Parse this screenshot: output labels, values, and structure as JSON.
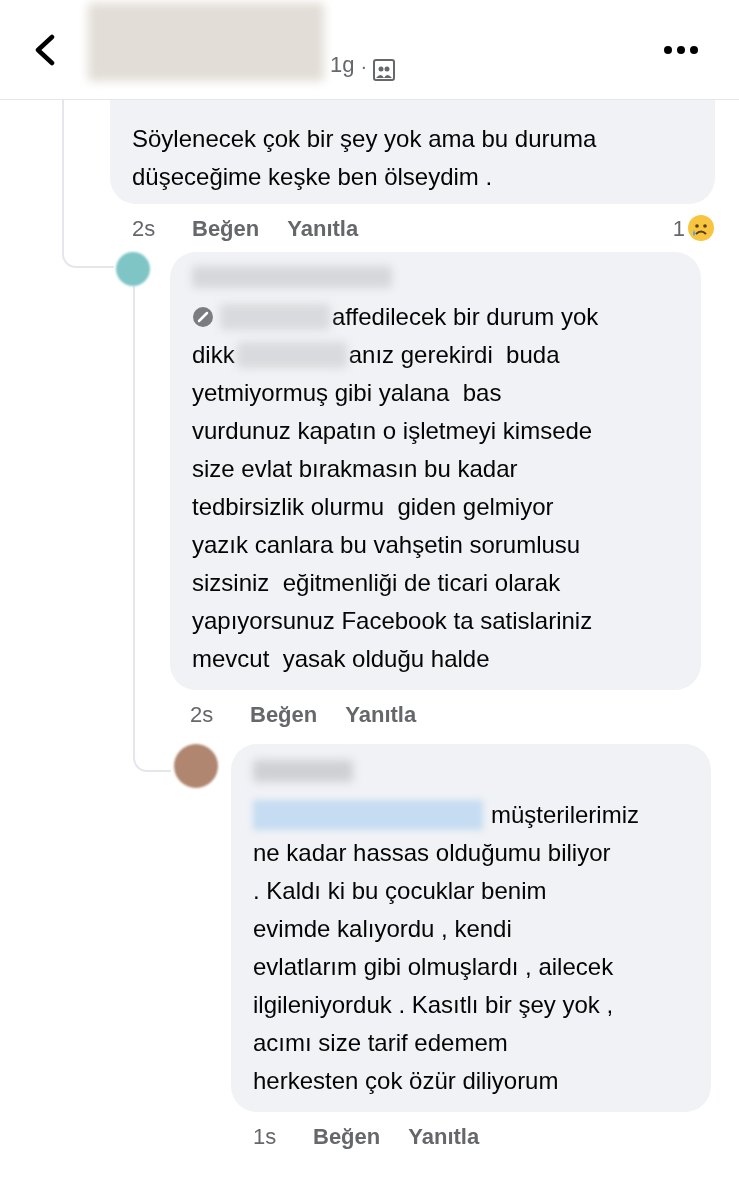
{
  "header": {
    "time": "1g",
    "separator": "·"
  },
  "comment": {
    "lines": [
      [
        {
          "kind": "text",
          "text": "Söylenecek çok bir şey yok ama bu duruma"
        }
      ],
      [
        {
          "kind": "text",
          "text": "düşeceğime keşke ben ölseydim ."
        }
      ]
    ],
    "time": "2s",
    "like": "Beğen",
    "reply": "Yanıtla",
    "reaction_count": "1",
    "reply_item": {
      "lines": [
        [
          {
            "kind": "badge"
          },
          {
            "kind": "redaction"
          },
          {
            "kind": "text",
            "text": "affedilecek bir durum yok"
          }
        ],
        [
          {
            "kind": "text",
            "text": "dikk"
          },
          {
            "kind": "redaction"
          },
          {
            "kind": "text",
            "text": "anız gerekirdi  buda"
          }
        ],
        [
          {
            "kind": "text",
            "text": "yetmiyormuş gibi yalana  bas"
          }
        ],
        [
          {
            "kind": "text",
            "text": "vurdunuz kapatın o işletmeyi kimsede"
          }
        ],
        [
          {
            "kind": "text",
            "text": "size evlat bırakmasın bu kadar"
          }
        ],
        [
          {
            "kind": "text",
            "text": "tedbirsizlik olurmu  giden gelmiyor"
          }
        ],
        [
          {
            "kind": "text",
            "text": "yazık canlara bu vahşetin sorumlusu"
          }
        ],
        [
          {
            "kind": "text",
            "text": "sizsiniz  eğitmenliği de ticari olarak"
          }
        ],
        [
          {
            "kind": "text",
            "text": "yapıyorsunuz Facebook ta satislariniz"
          }
        ],
        [
          {
            "kind": "text",
            "text": "mevcut  yasak olduğu halde"
          }
        ]
      ],
      "time": "2s",
      "like": "Beğen",
      "reply": "Yanıtla",
      "reply_item": {
        "lines": [
          [
            {
              "kind": "mention"
            },
            {
              "kind": "text",
              "text": "müşterilerimiz"
            }
          ],
          [
            {
              "kind": "text",
              "text": "ne kadar hassas olduğumu biliyor"
            }
          ],
          [
            {
              "kind": "text",
              "text": ". Kaldı ki bu çocuklar benim"
            }
          ],
          [
            {
              "kind": "text",
              "text": "evimde kalıyordu , kendi"
            }
          ],
          [
            {
              "kind": "text",
              "text": "evlatlarım gibi olmuşlardı , ailecek"
            }
          ],
          [
            {
              "kind": "text",
              "text": "ilgileniyorduk . Kasıtlı bir şey yok ,"
            }
          ],
          [
            {
              "kind": "text",
              "text": "acımı size tarif edemem"
            }
          ],
          [
            {
              "kind": "text",
              "text": "herkesten çok özür diliyorum"
            }
          ]
        ],
        "time": "1s",
        "like": "Beğen",
        "reply": "Yanıtla"
      }
    }
  }
}
